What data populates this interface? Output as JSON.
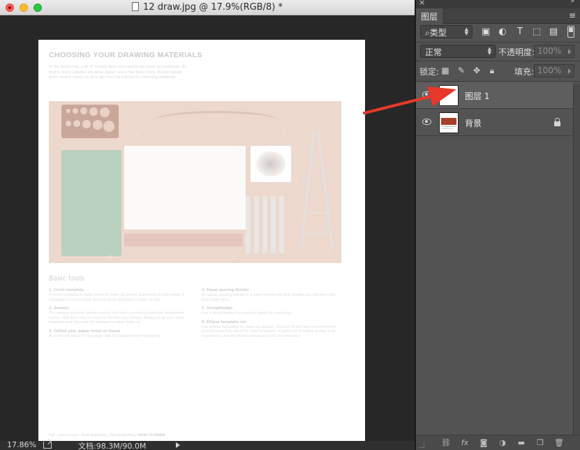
{
  "window": {
    "title": "12 draw.jpg @ 17.9%(RGB/8) *"
  },
  "document": {
    "title": "CHOOSING YOUR DRAWING MATERIALS",
    "intro": "In the beginning, a lot of money does not need to be spent on materials. All that is really needed are pens, paper and a few basic tools. Brand names don't matter much, so let's get into the criteria for choosing materials.",
    "photo_numbers": [
      "1",
      "2",
      "3",
      "4",
      "5",
      "6"
    ],
    "section_heading": "Basic tools",
    "left_items": [
      {
        "heading": "1. Circle template",
        "body": "A circle template is quite useful to clean up circles, especially in side views. A compass is nice to have, but the circle template is faster to use."
      },
      {
        "heading": "2. Sweeps",
        "body": "The sweeps pictured above contain the most commonly sketched automotive curves. But don't rely on them to dictate your design. Always draw your lines freehand and then use the sweeps to clean them up."
      },
      {
        "heading": "3. Cotton pad, paper towel or tissue",
        "body": "To avoid ink globs on the page, dab the ballpoint pen frequently."
      }
    ],
    "right_items": [
      {
        "heading": "4. Equal spacing divider",
        "body": "An equal spacing divider is a super-handy tool that divides any distance into even segments."
      },
      {
        "heading": "5. Straightedge",
        "body": "Use a straightedge to construct grids for underlays."
      },
      {
        "heading": "6. Ellipse template set",
        "body": "Use ellipse templates to clean up ellipses. Alvin or Pickett are recommended brands since they work for most situations. A good set of ellipse guides is an investment, but worthwhile because it will last decades."
      }
    ],
    "footer": {
      "page_number": "012",
      "authors": "Scott Robertson | Thomas Bertling |",
      "book": "HOW TO DRAW"
    }
  },
  "status_bar": {
    "zoom": "17.86%",
    "doc_size": "文档:98.3M/90.0M"
  },
  "panel": {
    "tab_label": "图层",
    "filter_select": "⌕类型",
    "blend_mode": "正常",
    "opacity_label": "不透明度:",
    "opacity_value": "100%",
    "lock_label": "锁定:",
    "fill_label": "填充:",
    "fill_value": "100%",
    "layers": [
      {
        "name": "图层 1",
        "selected": true
      },
      {
        "name": "背景",
        "locked": true
      }
    ]
  },
  "colors": {
    "panel_bg": "#535353",
    "canvas_bg": "#272727",
    "annotation": "#e8382b",
    "photo_wood": "#a84027"
  }
}
